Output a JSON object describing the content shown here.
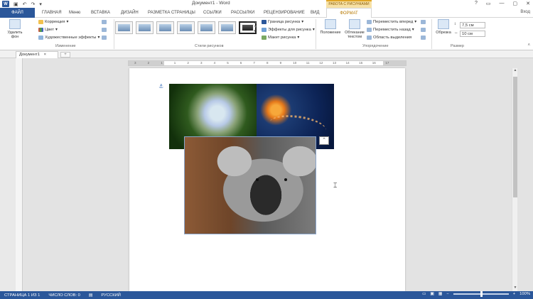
{
  "window": {
    "title": "Документ1 - Word",
    "contextual_group": "РАБОТА С РИСУНКАМИ",
    "controls": [
      "?",
      "▭",
      "—",
      "▢",
      "✕"
    ]
  },
  "qat": {
    "logo": "W",
    "icons": [
      "save-icon",
      "undo-icon",
      "redo-icon",
      "customize-icon"
    ]
  },
  "tabs": [
    "ФАЙЛ",
    "ГЛАВНАЯ",
    "Меню",
    "ВСТАВКА",
    "ДИЗАЙН",
    "РАЗМЕТКА СТРАНИЦЫ",
    "ССЫЛКИ",
    "РАССЫЛКИ",
    "РЕЦЕНЗИРОВАНИЕ",
    "ВИД",
    "ФОРМАТ"
  ],
  "active_tab": "ФОРМАТ",
  "account": "Вход",
  "ribbon": {
    "remove_bg": "Удалить\nфон",
    "correction": "Коррекция",
    "color": "Цвет",
    "artistic": "Художественные эффекты",
    "group_adjust": "Изменение",
    "group_styles": "Стили рисунков",
    "picture_border": "Граница рисунка",
    "picture_effects": "Эффекты для рисунка",
    "picture_layout": "Макет рисунка",
    "position": "Положение",
    "wrap_text": "Обтекание\nтекстом",
    "bring_forward": "Переместить вперед",
    "send_backward": "Переместить назад",
    "selection_pane": "Область выделения",
    "group_arrange": "Упорядочение",
    "crop": "Обрезка",
    "height": "7,5 см",
    "width": "10 см",
    "group_size": "Размер"
  },
  "document_tab": {
    "name": "Документ1",
    "close": "×",
    "new": "+"
  },
  "ruler": {
    "numbers": [
      "3",
      "2",
      "1",
      "1",
      "2",
      "3",
      "4",
      "5",
      "6",
      "7",
      "8",
      "9",
      "10",
      "11",
      "12",
      "13",
      "14",
      "15",
      "16",
      "17"
    ]
  },
  "status": {
    "page": "СТРАНИЦА 1 ИЗ 1",
    "words": "ЧИСЛО СЛОВ: 0",
    "language": "РУССКИЙ",
    "zoom": "100%"
  },
  "colors": {
    "accent": "#2b579a",
    "contextual": "#e0a526"
  }
}
